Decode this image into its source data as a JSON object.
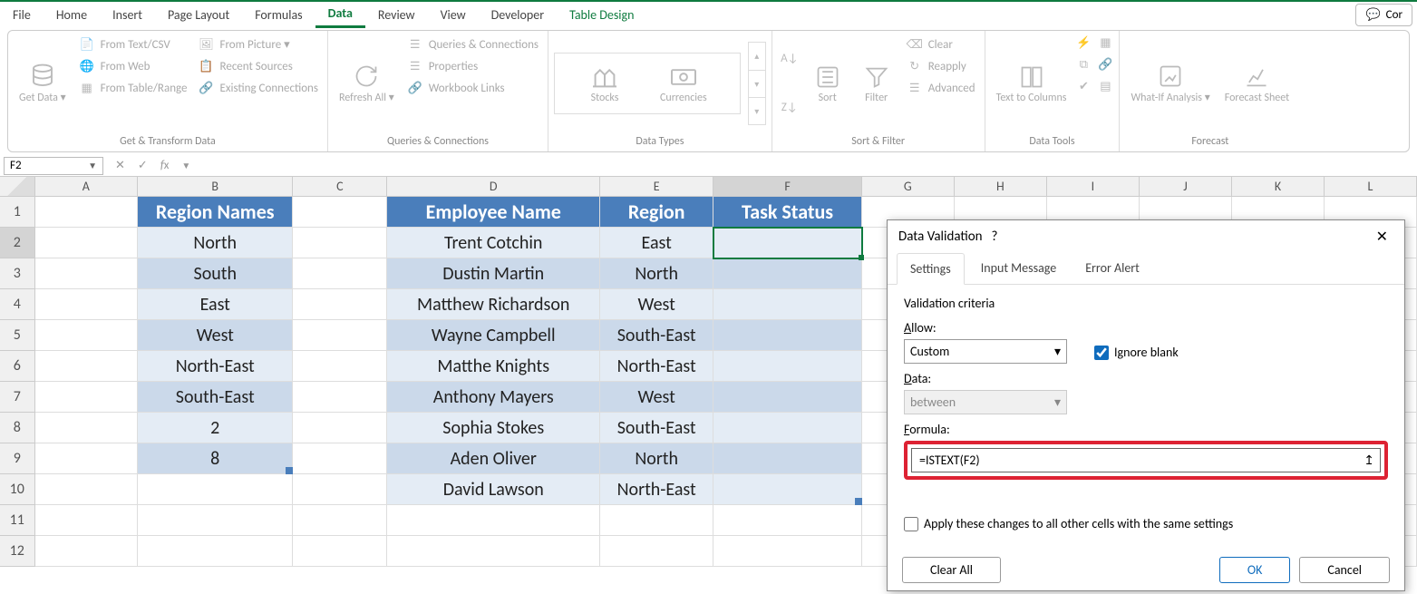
{
  "menu": {
    "file": "File",
    "home": "Home",
    "insert": "Insert",
    "pagelayout": "Page Layout",
    "formulas": "Formulas",
    "data": "Data",
    "review": "Review",
    "view": "View",
    "developer": "Developer",
    "tabledesign": "Table Design",
    "comments": "Cor"
  },
  "ribbon": {
    "getdata": "Get Data ▾",
    "fromtextcsv": "From Text/CSV",
    "fromweb": "From Web",
    "fromtable": "From Table/Range",
    "frompicture": "From Picture ▾",
    "recentsources": "Recent Sources",
    "existingconn": "Existing Connections",
    "group_get": "Get & Transform Data",
    "refreshall": "Refresh All ▾",
    "queries": "Queries & Connections",
    "properties": "Properties",
    "workbooklinks": "Workbook Links",
    "group_queries": "Queries & Connections",
    "stocks": "Stocks",
    "currencies": "Currencies",
    "group_datatypes": "Data Types",
    "sort": "Sort",
    "filter": "Filter",
    "clear": "Clear",
    "reapply": "Reapply",
    "advanced": "Advanced",
    "group_sortfilter": "Sort & Filter",
    "texttocol": "Text to Columns",
    "group_datatools": "Data Tools",
    "whatif": "What-If Analysis ▾",
    "forecast": "Forecast Sheet",
    "group_forecast": "Forecast"
  },
  "namebox": "F2",
  "columns": [
    "A",
    "B",
    "C",
    "D",
    "E",
    "F",
    "G",
    "H",
    "I",
    "J",
    "K",
    "L"
  ],
  "rows": [
    "1",
    "2",
    "3",
    "4",
    "5",
    "6",
    "7",
    "8",
    "9",
    "10",
    "11",
    "12"
  ],
  "table": {
    "B": {
      "header": "Region Names",
      "data": [
        "North",
        "South",
        "East",
        "West",
        "North-East",
        "South-East",
        "2",
        "8"
      ]
    },
    "D": {
      "header": "Employee Name",
      "data": [
        "Trent Cotchin",
        "Dustin Martin",
        "Matthew Richardson",
        "Wayne Campbell",
        "Matthe Knights",
        "Anthony Mayers",
        "Sophia Stokes",
        "Aden Oliver",
        "David Lawson"
      ]
    },
    "E": {
      "header": "Region",
      "data": [
        "East",
        "North",
        "West",
        "South-East",
        "North-East",
        "West",
        "South-East",
        "North",
        "North-East"
      ]
    },
    "F": {
      "header": "Task Status",
      "data": [
        "",
        "",
        "",
        "",
        "",
        "",
        "",
        "",
        ""
      ]
    }
  },
  "dialog": {
    "title": "Data Validation",
    "tabs": {
      "settings": "Settings",
      "input": "Input Message",
      "error": "Error Alert"
    },
    "criteria_label": "Validation criteria",
    "allow_label": "Allow:",
    "allow_value": "Custom",
    "ignore_blank": "Ignore blank",
    "data_label": "Data:",
    "data_value": "between",
    "formula_label": "Formula:",
    "formula_value": "=ISTEXT(F2)",
    "apply_all": "Apply these changes to all other cells with the same settings",
    "clear": "Clear All",
    "ok": "OK",
    "cancel": "Cancel"
  }
}
